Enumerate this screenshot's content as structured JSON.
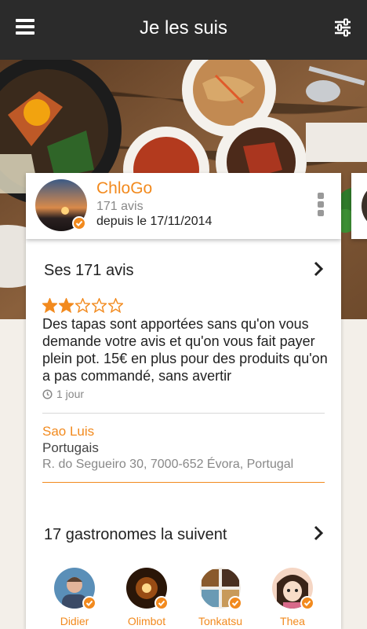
{
  "header": {
    "title": "Je les suis"
  },
  "profile": {
    "username": "ChloGo",
    "review_count": "171 avis",
    "since": "depuis le 17/11/2014"
  },
  "reviews_section": {
    "title": "Ses 171 avis",
    "latest": {
      "rating": 2,
      "max_rating": 5,
      "text": "Des tapas sont apportées sans qu'on vous demande votre avis et qu'on vous fait payer plein pot. 15€ en plus pour des produits qu'on a pas commandé, sans avertir",
      "time": "1 jour",
      "place_name": "Sao Luis",
      "place_type": "Portugais",
      "place_address": "R. do Segueiro 30, 7000-652 Évora, Portugal"
    }
  },
  "followers_section": {
    "title": "17 gastronomes la suivent",
    "followers": [
      {
        "name": "Didier"
      },
      {
        "name": "Olimbot"
      },
      {
        "name": "Tonkatsu"
      },
      {
        "name": "Thea"
      }
    ]
  },
  "colors": {
    "accent": "#f28a1e",
    "topbar": "#2b2b2b"
  },
  "icons": [
    "menu-icon",
    "filter-icon",
    "more-icon",
    "chevron-right-icon",
    "clock-icon",
    "verified-icon",
    "star-icon"
  ]
}
